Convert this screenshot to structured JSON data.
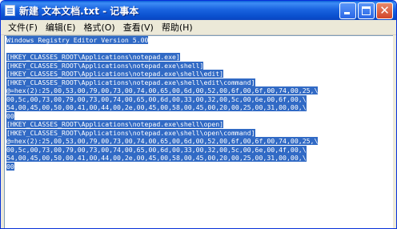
{
  "window": {
    "title": "新建 文本文档.txt - 记事本"
  },
  "menu": {
    "items": [
      "文件(F)",
      "编辑(E)",
      "格式(O)",
      "查看(V)",
      "帮助(H)"
    ]
  },
  "document": {
    "lines": [
      "Windows Registry Editor Version 5.00",
      "",
      "[HKEY_CLASSES_ROOT\\Applications\\notepad.exe]",
      "[HKEY_CLASSES_ROOT\\Applications\\notepad.exe\\shell]",
      "[HKEY_CLASSES_ROOT\\Applications\\notepad.exe\\shell\\edit]",
      "[HKEY_CLASSES_ROOT\\Applications\\notepad.exe\\shell\\edit\\command]",
      "@=hex(2):25,00,53,00,79,00,73,00,74,00,65,00,6d,00,52,00,6f,00,6f,00,74,00,25,\\",
      "00,5c,00,73,00,79,00,73,00,74,00,65,00,6d,00,33,00,32,00,5c,00,6e,00,6f,00,\\",
      "54,00,45,00,50,00,41,00,44,00,2e,00,45,00,58,00,45,00,20,00,25,00,31,00,00,\\",
      "00",
      "[HKEY_CLASSES_ROOT\\Applications\\notepad.exe\\shell\\open]",
      "[HKEY_CLASSES_ROOT\\Applications\\notepad.exe\\shell\\open\\command]",
      "@=hex(2):25,00,53,00,79,00,73,00,74,00,65,00,6d,00,52,00,6f,00,6f,00,74,00,25,\\",
      "00,5c,00,73,00,79,00,73,00,74,00,65,00,6d,00,33,00,32,00,5c,00,6e,00,4f,00,\\",
      "54,00,45,00,50,00,41,00,44,00,2e,00,45,00,58,00,45,00,20,00,25,00,31,00,00,\\",
      "00"
    ]
  },
  "colors": {
    "selection": "#316ac5",
    "titlebar": "#0a50cf",
    "menubar": "#ece9d8"
  }
}
